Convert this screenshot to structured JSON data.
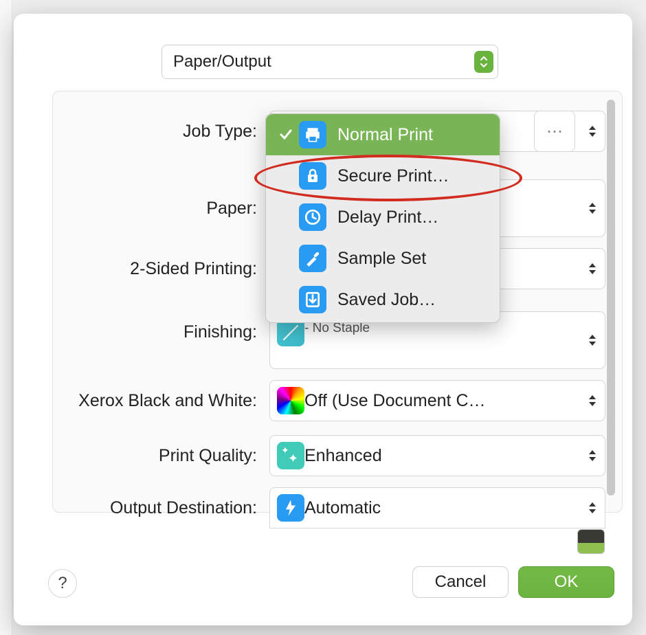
{
  "section_select": {
    "label": "Paper/Output"
  },
  "rows": {
    "jobtype": {
      "label": "Job Type:"
    },
    "paper": {
      "label": "Paper:"
    },
    "twosided": {
      "label": "2-Sided Printing:"
    },
    "finishing": {
      "label": "Finishing:",
      "value": "- No Staple"
    },
    "bw": {
      "label": "Xerox Black and White:",
      "value": "Off (Use Document C…"
    },
    "quality": {
      "label": "Print Quality:",
      "value": "Enhanced"
    },
    "output": {
      "label": "Output Destination:",
      "value": "Automatic"
    }
  },
  "jobtype_menu": {
    "items": [
      {
        "label": "Normal Print",
        "icon": "printer-icon",
        "selected": true
      },
      {
        "label": "Secure Print…",
        "icon": "lock-icon"
      },
      {
        "label": "Delay Print…",
        "icon": "clock-icon"
      },
      {
        "label": "Sample Set",
        "icon": "eyedropper-icon"
      },
      {
        "label": "Saved Job…",
        "icon": "download-icon"
      }
    ]
  },
  "buttons": {
    "extra": "⋯",
    "help": "?",
    "cancel": "Cancel",
    "ok": "OK"
  }
}
